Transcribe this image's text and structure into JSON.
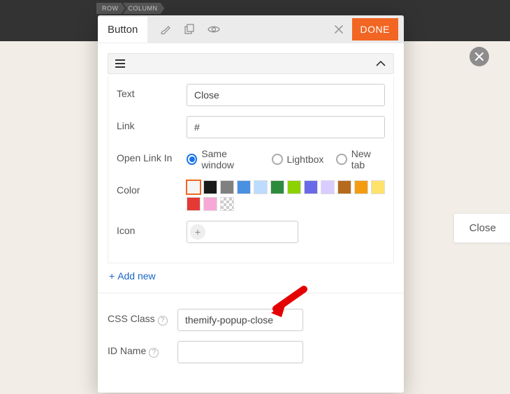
{
  "breadcrumb": {
    "row": "ROW",
    "col": "COLUMN"
  },
  "floating_close_btn_label": "Close",
  "panel": {
    "tab_label": "Button",
    "done_label": "DONE",
    "fields": {
      "text_label": "Text",
      "text_value": "Close",
      "link_label": "Link",
      "link_value": "#",
      "open_link_label": "Open Link In",
      "open_link_options": {
        "same": "Same window",
        "lightbox": "Lightbox",
        "newtab": "New tab"
      },
      "color_label": "Color",
      "icon_label": "Icon",
      "add_new_label": "Add new",
      "css_class_label": "CSS Class",
      "css_class_value": "themify-popup-close",
      "id_name_label": "ID Name",
      "id_name_value": ""
    },
    "colors": [
      "#f5f5f5",
      "#1a1a1a",
      "#808080",
      "#4a90e2",
      "#bcdcff",
      "#2e8b3d",
      "#8cd100",
      "#6a6ae8",
      "#d9ccff",
      "#b56a1e",
      "#f39c12",
      "#ffe26b",
      "#e53935",
      "#f8a8d6",
      "transparent"
    ]
  }
}
